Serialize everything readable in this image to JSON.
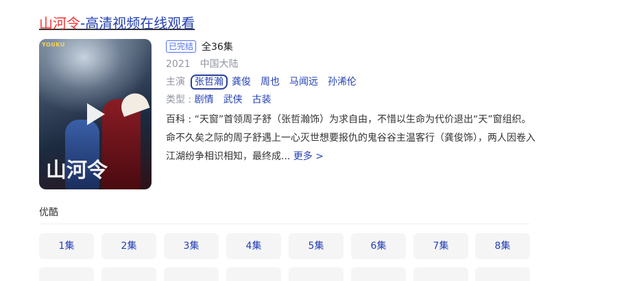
{
  "result": {
    "title_highlight": "山河令",
    "title_rest": "-高清视频在线观看"
  },
  "poster": {
    "logo_text": "YOUKU",
    "calligraphy": "山河令"
  },
  "meta": {
    "status_badge": "已完结",
    "episodes_total": "全36集",
    "year": "2021",
    "region": "中国大陆",
    "cast_label": "主演",
    "cast": [
      "张哲瀚",
      "龚俊",
      "周也",
      "马闻远",
      "孙浠伦"
    ],
    "genre_label": "类型 : ",
    "genres": [
      "剧情",
      "武侠",
      "古装"
    ]
  },
  "summary": {
    "text": "百科 : “天窗”首领周子舒（张哲瀚饰）为求自由，不惜以生命为代价退出“天”窗组织。命不久矣之际的周子舒遇上一心灭世想要报仇的鬼谷谷主温客行（龚俊饰），两人因卷入江湖纷争相识相知，最终成... ",
    "more_link": "更多 >"
  },
  "source": {
    "name": "优酷"
  },
  "episodes": [
    "1集",
    "2集",
    "3集",
    "4集",
    "5集",
    "6集",
    "7集",
    "8集"
  ]
}
